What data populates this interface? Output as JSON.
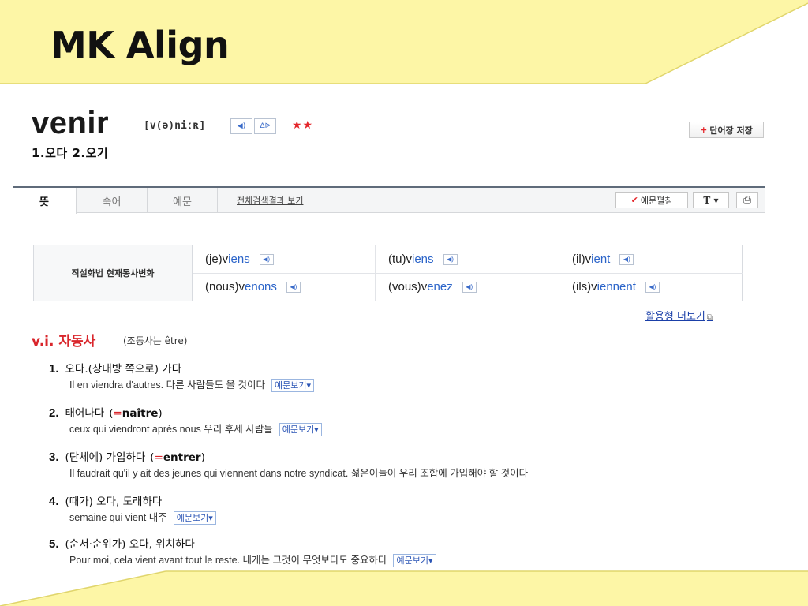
{
  "slide": {
    "title": "MK Align",
    "colors": {
      "band": "#fdf6a6",
      "band_line": "#e4d96a"
    }
  },
  "entry": {
    "headword": "venir",
    "pronunciation": "[v(ə)niːʀ]",
    "speaker_icon": "speaker-icon",
    "compare_icon": "compare-icon",
    "speaker_label": "◀)",
    "compare_label": "ᐃᐅ",
    "stars": "★★",
    "save_label": "단어장 저장",
    "save_plus": "+",
    "short_definition": "1.오다  2.오기"
  },
  "tabs": {
    "items": [
      {
        "label": "뜻"
      },
      {
        "label": "숙어"
      },
      {
        "label": "예문"
      }
    ],
    "search_all_label": "전체검색결과 보기",
    "expand_examples_label": "예문펼침",
    "check_mark": "✔",
    "font_size_label": "T ▾",
    "print_label": "⎙"
  },
  "conjugation": {
    "label": "직설화법 현재동사변화",
    "rows": [
      [
        {
          "pronoun": "(je)",
          "stem": "v",
          "ending": "iens"
        },
        {
          "pronoun": "(tu)",
          "stem": "v",
          "ending": "iens"
        },
        {
          "pronoun": "(il)",
          "stem": "v",
          "ending": "ient"
        }
      ],
      [
        {
          "pronoun": "(nous)",
          "stem": "v",
          "ending": "enons"
        },
        {
          "pronoun": "(vous)",
          "stem": "v",
          "ending": "enez"
        },
        {
          "pronoun": "(ils)",
          "stem": "v",
          "ending": "iennent"
        }
      ]
    ],
    "speaker_label": "◀)",
    "more_link": "활용형 더보기",
    "more_link_icon": "⧉"
  },
  "pos": {
    "label": "v.i. 자동사",
    "note": "(조동사는 être)"
  },
  "senses": [
    {
      "num": "1.",
      "text": "오다.(상대방 쪽으로) 가다",
      "synonym": "",
      "example": "Il en viendra d'autres. 다른 사람들도 올 것이다",
      "has_button": true
    },
    {
      "num": "2.",
      "text": "태어나다",
      "synonym": "naître",
      "example": "ceux qui viendront après nous 우리 후세 사람들",
      "has_button": true
    },
    {
      "num": "3.",
      "text": "(단체에) 가입하다",
      "synonym": "entrer",
      "example": "Il faudrait qu'il y ait des jeunes qui viennent dans notre syndicat. 젊은이들이 우리 조합에 가입해야 할 것이다",
      "has_button": false
    },
    {
      "num": "4.",
      "text": "(때가) 오다, 도래하다",
      "synonym": "",
      "example": "semaine qui vient 내주",
      "has_button": true
    },
    {
      "num": "5.",
      "text": "(순서·순위가) 오다, 위치하다",
      "synonym": "",
      "example": "Pour moi, cela vient avant tout le reste. 내게는 그것이 무엇보다도 중요하다",
      "has_button": true
    }
  ],
  "example_button_label": "예문보기▾",
  "synonym_open": "(",
  "synonym_eq": "=",
  "synonym_close": ")"
}
